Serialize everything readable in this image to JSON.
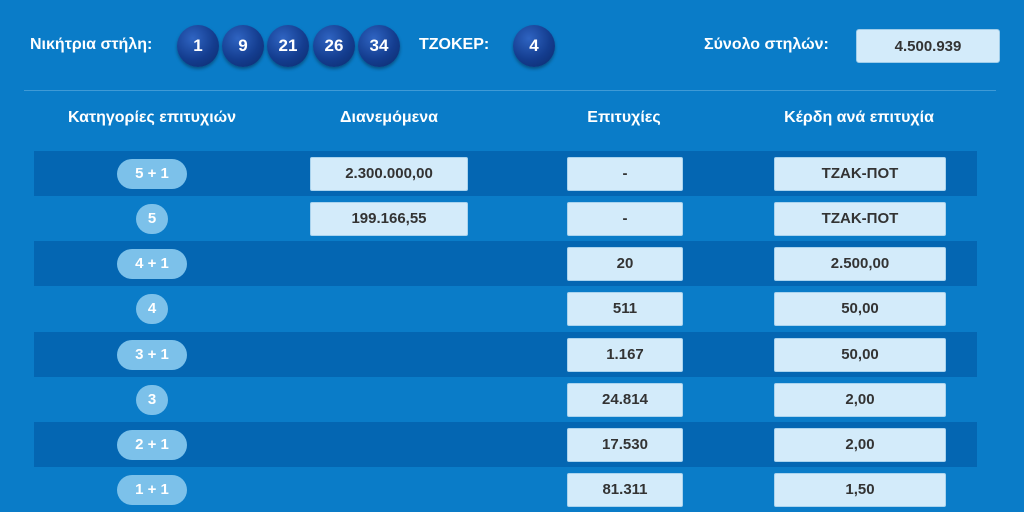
{
  "header": {
    "winning_label": "Νικήτρια στήλη:",
    "numbers": [
      "1",
      "9",
      "21",
      "26",
      "34"
    ],
    "joker_label": "ΤΖΟΚΕΡ:",
    "joker": "4",
    "total_label": "Σύνολο στηλών:",
    "total_value": "4.500.939"
  },
  "table": {
    "headers": [
      "Κατηγορίες επιτυχιών",
      "Διανεμόμενα",
      "Επιτυχίες",
      "Κέρδη ανά επιτυχία"
    ],
    "rows": [
      {
        "category": "5 + 1",
        "distributed": "2.300.000,00",
        "winners": "-",
        "prize": "ΤΖΑΚ-ΠΟΤ"
      },
      {
        "category": "5",
        "distributed": "199.166,55",
        "winners": "-",
        "prize": "ΤΖΑΚ-ΠΟΤ"
      },
      {
        "category": "4 + 1",
        "distributed": "",
        "winners": "20",
        "prize": "2.500,00"
      },
      {
        "category": "4",
        "distributed": "",
        "winners": "511",
        "prize": "50,00"
      },
      {
        "category": "3 + 1",
        "distributed": "",
        "winners": "1.167",
        "prize": "50,00"
      },
      {
        "category": "3",
        "distributed": "",
        "winners": "24.814",
        "prize": "2,00"
      },
      {
        "category": "2 + 1",
        "distributed": "",
        "winners": "17.530",
        "prize": "2,00"
      },
      {
        "category": "1 + 1",
        "distributed": "",
        "winners": "81.311",
        "prize": "1,50"
      }
    ]
  },
  "colors": {
    "background": "#0a7cc8",
    "row_stripe": "#0466b2",
    "ball": "#143d8f",
    "value_box": "#d3ebfa",
    "category_pill": "#7cc1ea"
  }
}
